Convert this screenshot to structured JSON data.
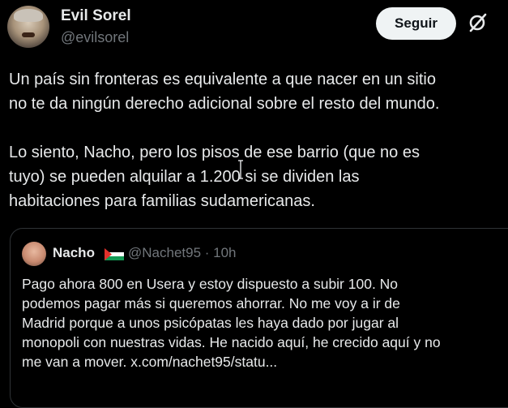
{
  "author": {
    "name": "Evil Sorel",
    "handle": "@evilsorel"
  },
  "follow_label": "Seguir",
  "tweet": {
    "text": "Un país sin fronteras es equivalente a que nacer en un sitio\nno te da ningún derecho adicional sobre el resto del mundo.\n\nLo siento, Nacho, pero los pisos de ese barrio (que no es\ntuyo) se pueden alquilar a 1.200 si se dividen las\nhabitaciones para familias sudamericanas."
  },
  "quoted": {
    "name": "Nacho",
    "handle_time": "@Nachet95 · 10h",
    "text": "Pago ahora 800 en Usera y estoy dispuesto a subir 100. No\npodemos pagar más si queremos ahorrar. No me voy a ir de\nMadrid porque a unos psicópatas les haya dado por jugar al\nmonopoli con nuestras vidas. He nacido aquí, he crecido aquí y no\nme van a mover. x.com/nachet95/statu..."
  },
  "icons": {
    "grok": "grok-icon",
    "flag": "palestine-flag-icon"
  },
  "colors": {
    "background": "#000000",
    "text": "#e7e9ea",
    "secondary_text": "#71767b",
    "button_bg": "#eff3f4",
    "border": "#2f3336"
  }
}
